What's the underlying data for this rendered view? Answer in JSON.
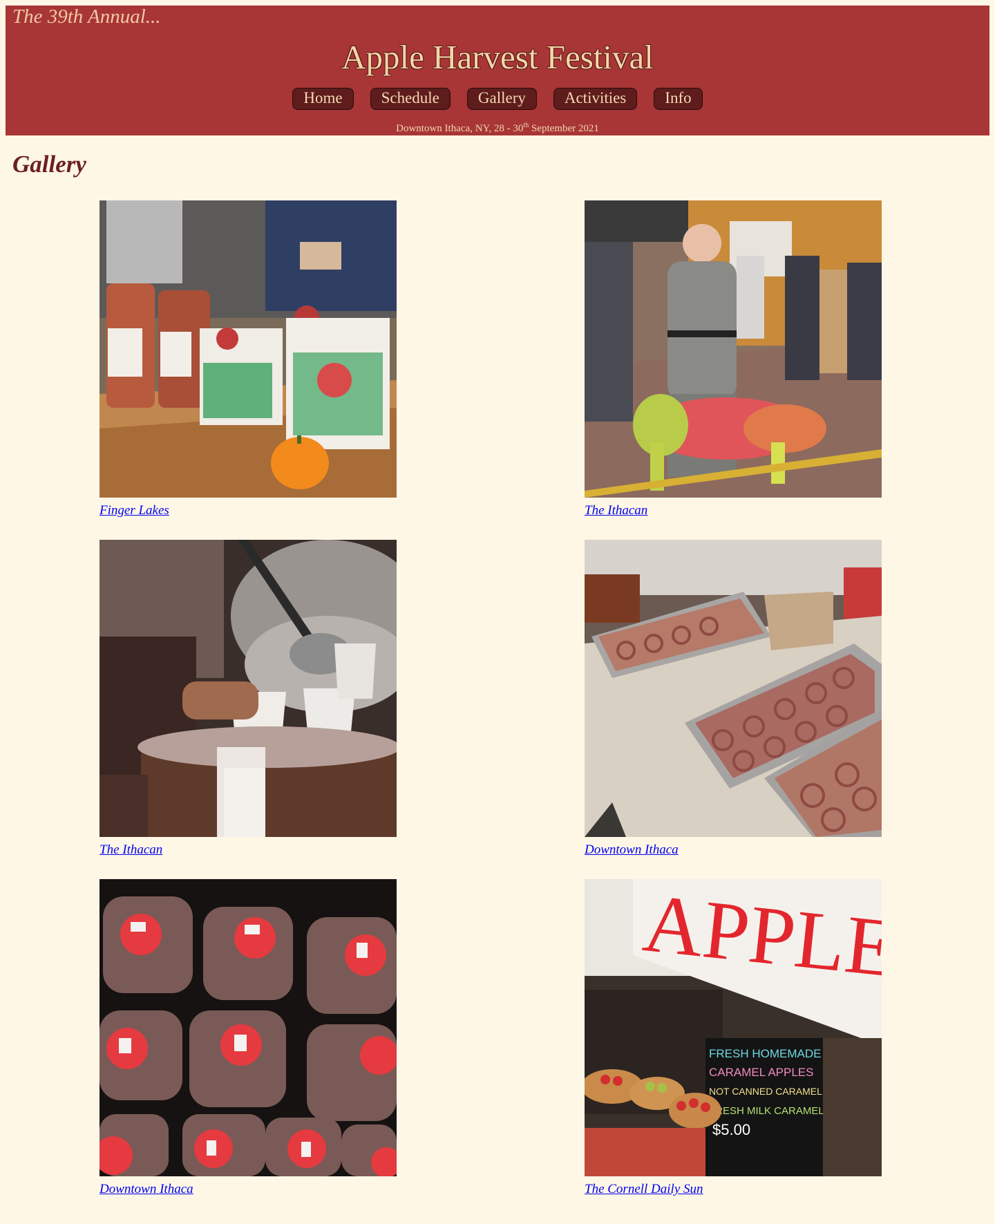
{
  "header": {
    "tagline": "The 39th Annual...",
    "title": "Apple Harvest Festival",
    "nav": [
      {
        "label": "Home"
      },
      {
        "label": "Schedule"
      },
      {
        "label": "Gallery"
      },
      {
        "label": "Activities"
      },
      {
        "label": "Info"
      }
    ],
    "dates_prefix": "Downtown Ithaca, NY, 28 - 30",
    "dates_sup": "th",
    "dates_suffix": " September 2021"
  },
  "main": {
    "heading": "Gallery",
    "photos": [
      {
        "caption": "Finger Lakes",
        "subject": "cider jugs and apple bags on market table"
      },
      {
        "caption": "The Ithacan",
        "subject": "woman with dyed dog at street festival"
      },
      {
        "caption": "The Ithacan",
        "subject": "ladling hot cider into cups"
      },
      {
        "caption": "Downtown Ithaca",
        "subject": "trays of cider donuts"
      },
      {
        "caption": "Downtown Ithaca",
        "subject": "overhead view of cider jugs with red caps"
      },
      {
        "caption": "The Cornell Daily Sun",
        "subject": "APPLES sign and caramel apple stand"
      }
    ],
    "photo_texts": {
      "apples_sign": "APPLES",
      "chalkboard": [
        "FRESH HOMEMADE",
        "CARAMEL APPLES",
        "NOT CANNED CARAMEL",
        "FRESH MILK CARAMEL",
        "$5.00"
      ]
    }
  },
  "colors": {
    "page_bg": "#fff7e6",
    "header_bg": "#a83636",
    "nav_bg": "#5e1c1c",
    "heading": "#6b2020",
    "link": "#0000ee"
  }
}
